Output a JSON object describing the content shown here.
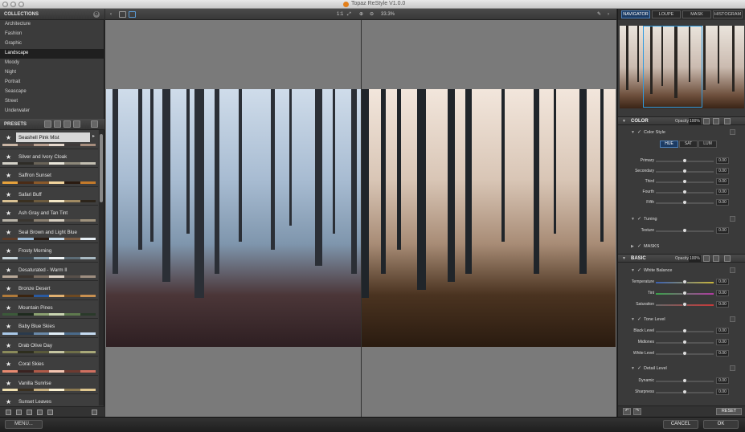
{
  "window": {
    "title": "Topaz ReStyle V1.0.0"
  },
  "collections": {
    "header": "COLLECTIONS",
    "items": [
      "Architecture",
      "Fashion",
      "Graphic",
      "Landscape",
      "Moody",
      "Night",
      "Portrait",
      "Seascape",
      "Street",
      "Underwater"
    ],
    "selected": "Landscape"
  },
  "presets": {
    "header": "PRESETS",
    "items": [
      {
        "name": "Seashell Pink Mist",
        "swatches": [
          "#c9b5a4",
          "#5a4b46",
          "#b9a090",
          "#e5d7cc",
          "#3f3a3a",
          "#a68d7d"
        ]
      },
      {
        "name": "Silver and Ivory Cloak",
        "swatches": [
          "#d4d2c8",
          "#2e2c27",
          "#6a6458",
          "#e9e6da",
          "#8d887a",
          "#c3bfb2"
        ]
      },
      {
        "name": "Saffron Sunset",
        "swatches": [
          "#e7a23b",
          "#4a2b16",
          "#8c5a2a",
          "#f2d39b",
          "#2a1a10",
          "#c47a2a"
        ]
      },
      {
        "name": "Safari Buff",
        "swatches": [
          "#d9c193",
          "#3a3020",
          "#6e5c3e",
          "#f3e6c4",
          "#a08a62",
          "#2c241a"
        ]
      },
      {
        "name": "Ash Gray and Tan Tint",
        "swatches": [
          "#b9b4a8",
          "#3a3630",
          "#8b8070",
          "#d7cfc0",
          "#5e5850",
          "#a0937d"
        ]
      },
      {
        "name": "Seal Brown and Light Blue",
        "swatches": [
          "#5a3b28",
          "#9bbbd8",
          "#2b1e16",
          "#c8dcec",
          "#7a5c44",
          "#e6eef4"
        ]
      },
      {
        "name": "Frosty Morning",
        "swatches": [
          "#c9d6dc",
          "#3e4a52",
          "#8aa0ad",
          "#eef3f5",
          "#5c6c76",
          "#a8b9c2"
        ]
      },
      {
        "name": "Desaturated - Warm II",
        "swatches": [
          "#b8a898",
          "#3c342e",
          "#7c6e62",
          "#dcd0c4",
          "#58504a",
          "#9e8e80"
        ]
      },
      {
        "name": "Bronze Desert",
        "swatches": [
          "#b07a3a",
          "#3a2410",
          "#2a5aa0",
          "#e0b070",
          "#6e4a22",
          "#c89050"
        ]
      },
      {
        "name": "Mountain Pines",
        "swatches": [
          "#3c5a3a",
          "#1e2a1e",
          "#8aa070",
          "#c8d4b0",
          "#5e7a4e",
          "#2a3a2a"
        ]
      },
      {
        "name": "Baby Blue Skies",
        "swatches": [
          "#a8c8e8",
          "#2a3a4c",
          "#6a8aaa",
          "#e0eef8",
          "#4a6a8a",
          "#c4daf0"
        ]
      },
      {
        "name": "Drab Olive Day",
        "swatches": [
          "#8a8a5a",
          "#2e2e1e",
          "#5a5a3a",
          "#c4c4a0",
          "#6e6e48",
          "#a8a878"
        ]
      },
      {
        "name": "Coral Skies",
        "swatches": [
          "#e88a70",
          "#3a2220",
          "#b05a48",
          "#f4c4b0",
          "#6e3a30",
          "#d07060"
        ]
      },
      {
        "name": "Vanilla Sunrise",
        "swatches": [
          "#f0e0b0",
          "#3a3020",
          "#c8b080",
          "#faf0d0",
          "#8a7850",
          "#e0c890"
        ]
      },
      {
        "name": "Sunset Leaves",
        "swatches": [
          "#c05a2a",
          "#3a1a0a",
          "#e08a40",
          "#f4c080",
          "#7a3a1a",
          "#a04a20"
        ]
      }
    ]
  },
  "toolbar": {
    "zoom_1to1": "1:1",
    "zoom_value": "33.3%"
  },
  "navigator": {
    "tabs": [
      "NAVIGATOR",
      "LOUPE",
      "MASK",
      "HISTOGRAM"
    ],
    "active": "NAVIGATOR"
  },
  "color": {
    "title": "COLOR",
    "opacity_label": "Opacity:",
    "opacity_value": "100%",
    "color_style": "Color Style",
    "modes": [
      "HUE",
      "SAT",
      "LUM"
    ],
    "active_mode": "HUE",
    "sliders": [
      {
        "label": "Primary",
        "value": "0.00"
      },
      {
        "label": "Secondary",
        "value": "0.00"
      },
      {
        "label": "Third",
        "value": "0.00"
      },
      {
        "label": "Fourth",
        "value": "0.00"
      },
      {
        "label": "Fifth",
        "value": "0.00"
      }
    ],
    "tuning": "Tuning",
    "texture": {
      "label": "Texture",
      "value": "0.00"
    },
    "masks": "MASKS"
  },
  "basic": {
    "title": "BASIC",
    "opacity_label": "Opacity:",
    "opacity_value": "100%",
    "white_balance": "White Balance",
    "wb_sliders": [
      {
        "label": "Temperature",
        "value": "0.00"
      },
      {
        "label": "Tint",
        "value": "0.00"
      },
      {
        "label": "Saturation",
        "value": "0.00"
      }
    ],
    "tone_level": "Tone Level",
    "tone_sliders": [
      {
        "label": "Black Level",
        "value": "0.00"
      },
      {
        "label": "Midtones",
        "value": "0.00"
      },
      {
        "label": "White Level",
        "value": "0.00"
      }
    ],
    "detail_level": "Detail Level",
    "detail_sliders": [
      {
        "label": "Dynamic",
        "value": "0.00"
      },
      {
        "label": "Sharpness",
        "value": "0.00"
      }
    ]
  },
  "buttons": {
    "reset": "RESET",
    "menu": "MENU...",
    "cancel": "CANCEL",
    "ok": "OK"
  }
}
